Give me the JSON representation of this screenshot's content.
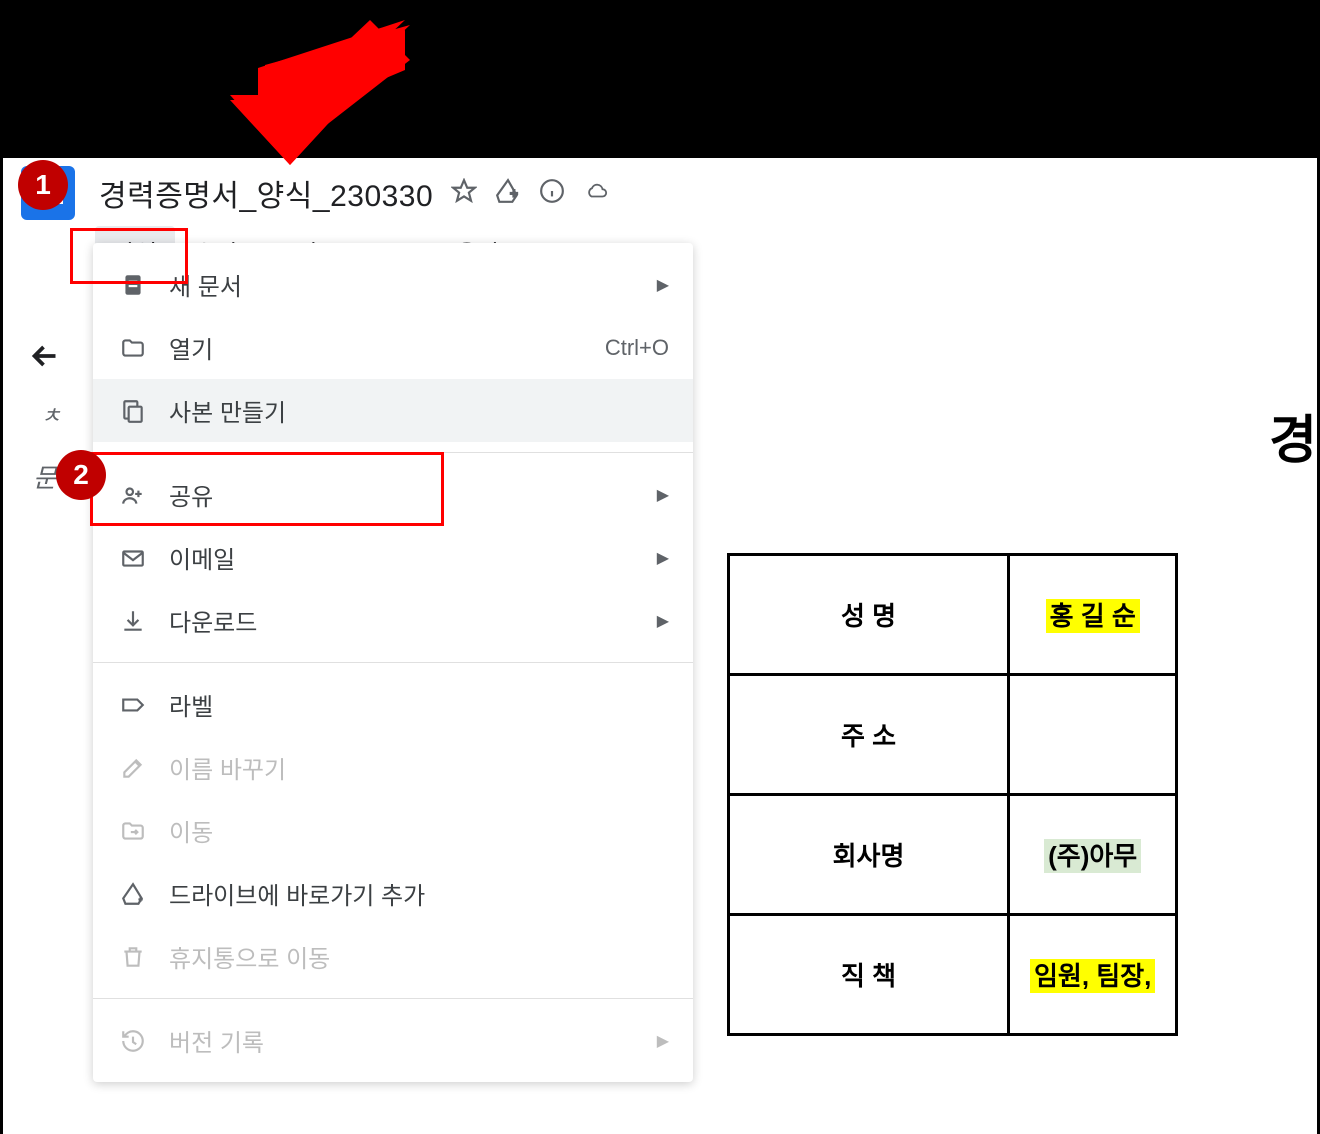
{
  "annotations": {
    "callout1": "1",
    "callout2": "2"
  },
  "document": {
    "title": "경력증명서_양식_230330",
    "heading": "경",
    "table": {
      "rows": [
        {
          "label": "성 명",
          "value": "홍 길 순",
          "highlight": "yellow"
        },
        {
          "label": "주 소",
          "value": "",
          "highlight": "none"
        },
        {
          "label": "회사명",
          "value": "(주)아무",
          "highlight": "green"
        },
        {
          "label": "직 책",
          "value": "임원, 팀장,",
          "highlight": "yellow"
        }
      ]
    }
  },
  "menubar": {
    "items": [
      "파일",
      "수정",
      "보기",
      "도구",
      "도움말"
    ]
  },
  "sidebar": {
    "truncated1": "ㅊ",
    "truncated2": "문서"
  },
  "dropdown": {
    "items": [
      {
        "icon": "doc",
        "label": "새 문서",
        "shortcut": "",
        "hasArrow": true,
        "disabled": false
      },
      {
        "icon": "folder",
        "label": "열기",
        "shortcut": "Ctrl+O",
        "hasArrow": false,
        "disabled": false
      },
      {
        "icon": "copy",
        "label": "사본 만들기",
        "shortcut": "",
        "hasArrow": false,
        "disabled": false,
        "hover": true
      },
      {
        "separator": true
      },
      {
        "icon": "share",
        "label": "공유",
        "shortcut": "",
        "hasArrow": true,
        "disabled": false
      },
      {
        "icon": "email",
        "label": "이메일",
        "shortcut": "",
        "hasArrow": true,
        "disabled": false
      },
      {
        "icon": "download",
        "label": "다운로드",
        "shortcut": "",
        "hasArrow": true,
        "disabled": false
      },
      {
        "separator": true
      },
      {
        "icon": "label",
        "label": "라벨",
        "shortcut": "",
        "hasArrow": false,
        "disabled": false
      },
      {
        "icon": "rename",
        "label": "이름 바꾸기",
        "shortcut": "",
        "hasArrow": false,
        "disabled": true
      },
      {
        "icon": "move",
        "label": "이동",
        "shortcut": "",
        "hasArrow": false,
        "disabled": true
      },
      {
        "icon": "drive-add",
        "label": "드라이브에 바로가기 추가",
        "shortcut": "",
        "hasArrow": false,
        "disabled": false
      },
      {
        "icon": "trash",
        "label": "휴지통으로 이동",
        "shortcut": "",
        "hasArrow": false,
        "disabled": true
      },
      {
        "separator": true
      },
      {
        "icon": "history",
        "label": "버전 기록",
        "shortcut": "",
        "hasArrow": true,
        "disabled": true
      }
    ]
  }
}
